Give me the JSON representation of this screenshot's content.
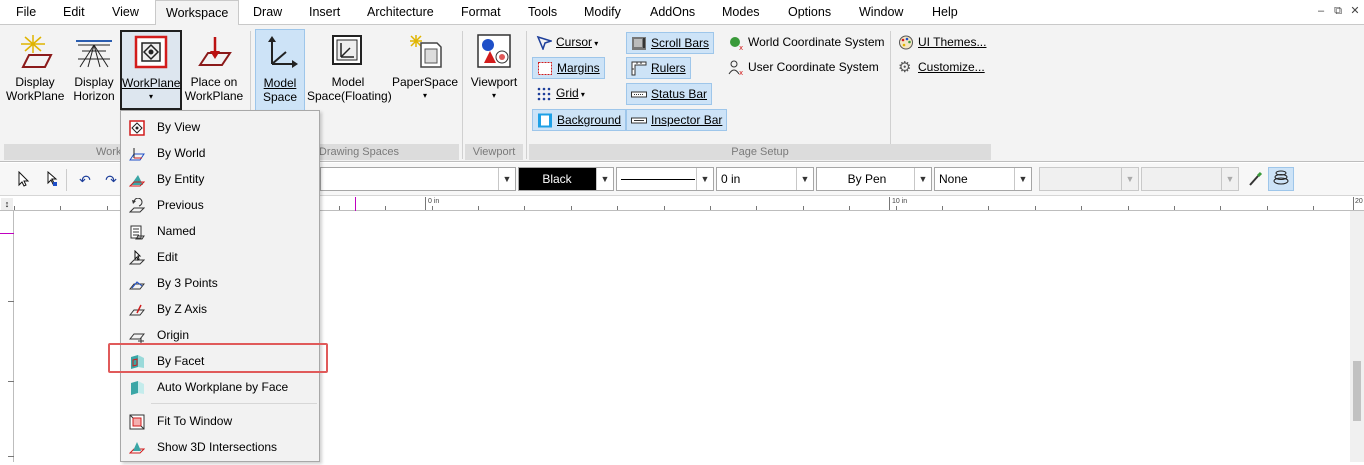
{
  "menubar": {
    "items": [
      "File",
      "Edit",
      "View",
      "Workspace",
      "Draw",
      "Insert",
      "Architecture",
      "Format",
      "Tools",
      "Modify",
      "AddOns",
      "Modes",
      "Options",
      "Window",
      "Help"
    ],
    "controls": [
      "–",
      "⧉",
      "✕"
    ]
  },
  "ribbon": {
    "display_workplane": [
      "Display",
      "WorkPlane"
    ],
    "display_horizon": [
      "Display",
      "Horizon"
    ],
    "workplane": "WorkPlane",
    "place_on_workplane": [
      "Place on",
      "WorkPlane"
    ],
    "model_space": [
      "Model",
      "Space"
    ],
    "model_space_floating": [
      "Model",
      "Space(Floating)"
    ],
    "paperspace": "PaperSpace",
    "viewport": "Viewport",
    "cursor": "Cursor",
    "margins": "Margins",
    "grid": "Grid",
    "background": "Background",
    "scroll_bars": "Scroll Bars",
    "rulers": "Rulers",
    "status_bar": "Status Bar",
    "inspector_bar": "Inspector Bar",
    "wcs": "World Coordinate System",
    "ucs": "User Coordinate System",
    "ui_themes": "UI Themes...",
    "customize": "Customize...",
    "groups": {
      "workplane": "Work",
      "drawing_spaces": "Drawing Spaces",
      "viewport": "Viewport",
      "page_setup": "Page Setup"
    }
  },
  "toolbar": {
    "color_value": "Black",
    "thickness_value": "0 in",
    "pen_value": "By Pen",
    "pattern_value": "None"
  },
  "ruler": {
    "labels": [
      "0 in",
      "10 in",
      "20"
    ]
  },
  "workplane_menu": {
    "items": [
      "By View",
      "By World",
      "By Entity",
      "Previous",
      "Named",
      "Edit",
      "By 3 Points",
      "By Z Axis",
      "Origin",
      "By Facet",
      "Auto Workplane by Face",
      "Fit To Window",
      "Show 3D Intersections"
    ],
    "highlighted": "By Facet"
  },
  "colors": {
    "ribbon_bg": "#f3f3f3",
    "selected_bg": "#cde3f7",
    "highlight_border": "#e05a5a",
    "color_swatch": "#000000"
  }
}
